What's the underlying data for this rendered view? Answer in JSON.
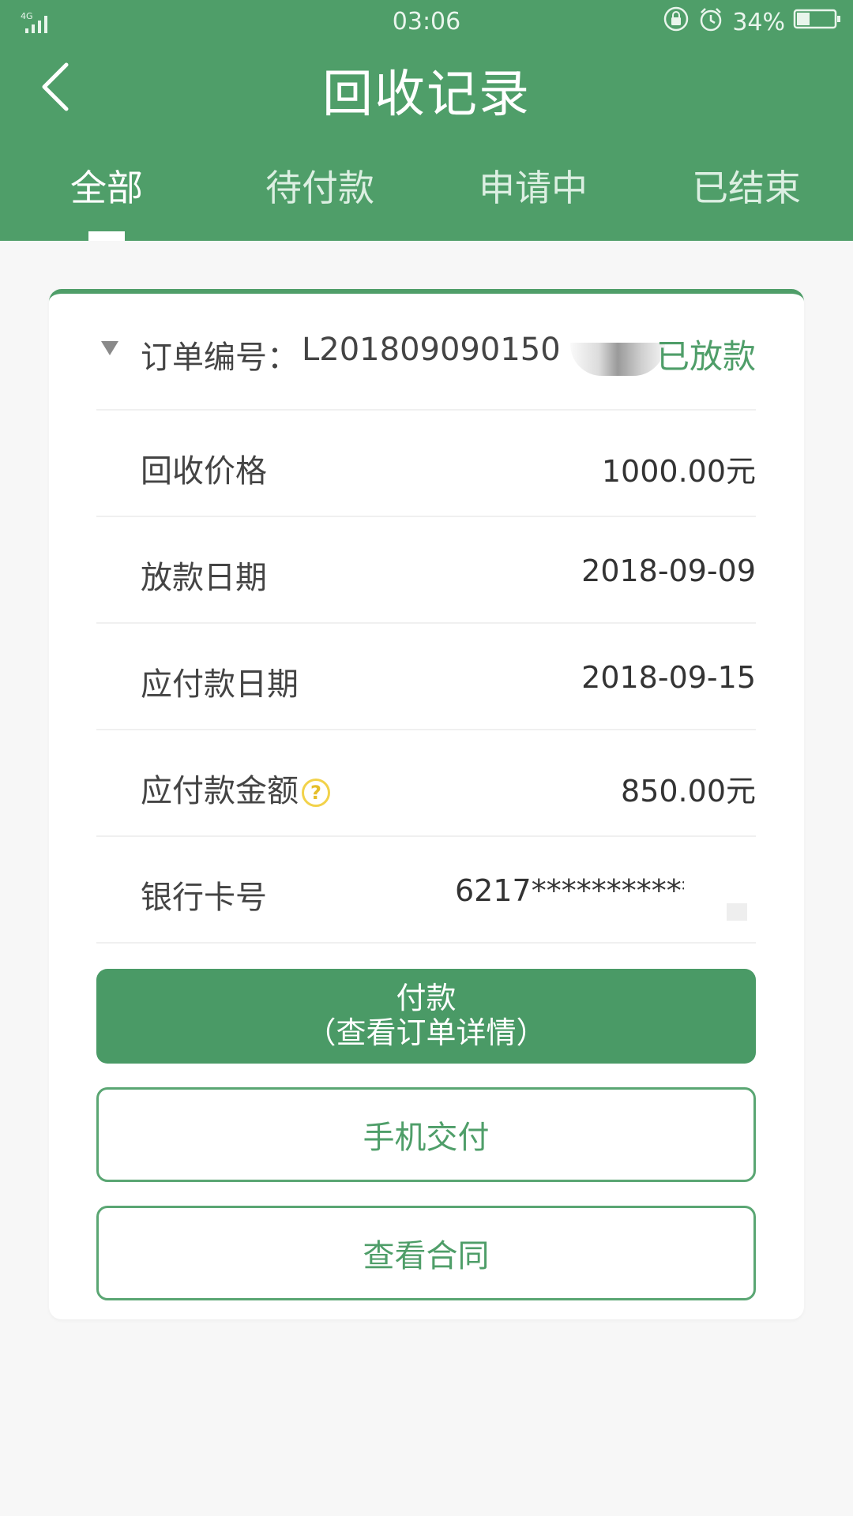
{
  "status_bar": {
    "network": "4G",
    "time": "03:06",
    "battery": "34%",
    "battery_level": 0.34,
    "icons": [
      "signal-icon",
      "lock-rotation-icon",
      "alarm-icon",
      "battery-icon"
    ]
  },
  "header": {
    "title": "回收记录",
    "back_icon": "back-chevron-icon"
  },
  "tabs": [
    {
      "label": "全部",
      "active": true
    },
    {
      "label": "待付款",
      "active": false
    },
    {
      "label": "申请中",
      "active": false
    },
    {
      "label": "已结束",
      "active": false
    }
  ],
  "order": {
    "label": "订单编号：",
    "id": "L201809090150",
    "status": "已放款",
    "rows": [
      {
        "label": "回收价格",
        "value": "1000.00元"
      },
      {
        "label": "放款日期",
        "value": "2018-09-09"
      },
      {
        "label": "应付款日期",
        "value": "2018-09-15"
      },
      {
        "label": "应付款金额",
        "value": "850.00元"
      },
      {
        "label": "银行卡号",
        "value": "6217***********"
      }
    ]
  },
  "buttons": {
    "pay_line1": "付款",
    "pay_line2": "（查看订单详情）",
    "phone_pay": "手机交付",
    "view_contract": "查看合同"
  },
  "colors": {
    "brand": "#4f9e69",
    "background": "#f7f7f7",
    "help_icon": "#f2d24a"
  }
}
